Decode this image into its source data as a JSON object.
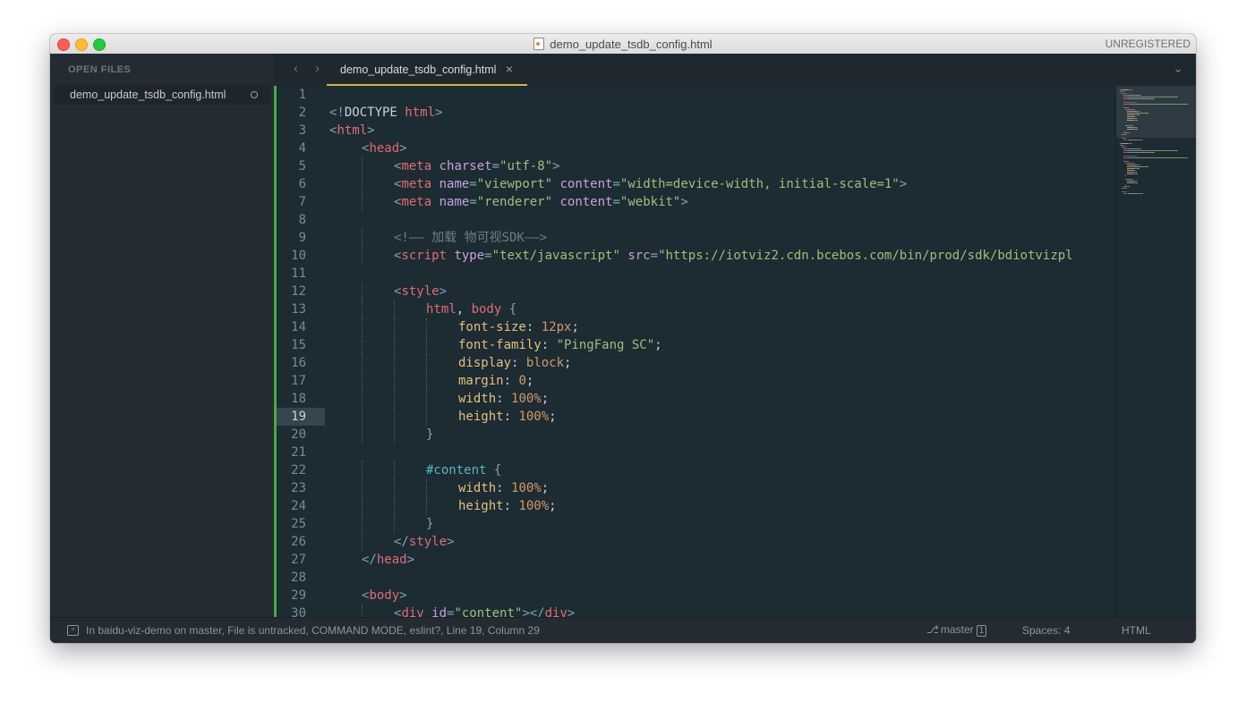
{
  "window": {
    "title": "demo_update_tsdb_config.html",
    "registration": "UNREGISTERED"
  },
  "sidebar": {
    "heading": "OPEN FILES",
    "files": [
      {
        "name": "demo_update_tsdb_config.html"
      }
    ]
  },
  "tabs": {
    "back": "‹",
    "forward": "›",
    "active": {
      "label": "demo_update_tsdb_config.html",
      "close": "×"
    },
    "menu": "⌄"
  },
  "editor": {
    "current_line": 19,
    "lines": [
      {
        "n": "1",
        "indent": 0,
        "tokens": []
      },
      {
        "n": "2",
        "indent": 0,
        "tokens": [
          [
            "punc",
            "<!"
          ],
          [
            "plain",
            "DOCTYPE "
          ],
          [
            "tag",
            "html"
          ],
          [
            "punc",
            ">"
          ]
        ]
      },
      {
        "n": "3",
        "indent": 0,
        "tokens": [
          [
            "punc",
            "<"
          ],
          [
            "tag",
            "html"
          ],
          [
            "punc",
            ">"
          ]
        ]
      },
      {
        "n": "4",
        "indent": 1,
        "tokens": [
          [
            "punc",
            "<"
          ],
          [
            "tag",
            "head"
          ],
          [
            "punc",
            ">"
          ]
        ]
      },
      {
        "n": "5",
        "indent": 2,
        "tokens": [
          [
            "punc",
            "<"
          ],
          [
            "tag",
            "meta "
          ],
          [
            "attr",
            "charset"
          ],
          [
            "punc",
            "="
          ],
          [
            "str",
            "\"utf-8\""
          ],
          [
            "punc",
            ">"
          ]
        ]
      },
      {
        "n": "6",
        "indent": 2,
        "tokens": [
          [
            "punc",
            "<"
          ],
          [
            "tag",
            "meta "
          ],
          [
            "attr",
            "name"
          ],
          [
            "punc",
            "="
          ],
          [
            "str",
            "\"viewport\" "
          ],
          [
            "attr",
            "content"
          ],
          [
            "punc",
            "="
          ],
          [
            "str",
            "\"width=device-width, initial-scale=1\""
          ],
          [
            "punc",
            ">"
          ]
        ]
      },
      {
        "n": "7",
        "indent": 2,
        "tokens": [
          [
            "punc",
            "<"
          ],
          [
            "tag",
            "meta "
          ],
          [
            "attr",
            "name"
          ],
          [
            "punc",
            "="
          ],
          [
            "str",
            "\"renderer\" "
          ],
          [
            "attr",
            "content"
          ],
          [
            "punc",
            "="
          ],
          [
            "str",
            "\"webkit\""
          ],
          [
            "punc",
            ">"
          ]
        ]
      },
      {
        "n": "8",
        "indent": 0,
        "tokens": []
      },
      {
        "n": "9",
        "indent": 2,
        "tokens": [
          [
            "comment",
            "<!—— 加载 物可视SDK——>"
          ]
        ]
      },
      {
        "n": "10",
        "indent": 2,
        "tokens": [
          [
            "punc",
            "<"
          ],
          [
            "tag",
            "script "
          ],
          [
            "attr",
            "type"
          ],
          [
            "punc",
            "="
          ],
          [
            "str",
            "\"text/javascript\" "
          ],
          [
            "attr",
            "src"
          ],
          [
            "punc",
            "="
          ],
          [
            "str",
            "\"https://iotviz2.cdn.bcebos.com/bin/prod/sdk/bdiotvizpl"
          ]
        ]
      },
      {
        "n": "11",
        "indent": 0,
        "tokens": []
      },
      {
        "n": "12",
        "indent": 2,
        "tokens": [
          [
            "punc",
            "<"
          ],
          [
            "tag",
            "style"
          ],
          [
            "punc",
            ">"
          ]
        ]
      },
      {
        "n": "13",
        "indent": 3,
        "tokens": [
          [
            "tag",
            "html"
          ],
          [
            "plain",
            ", "
          ],
          [
            "tag",
            "body "
          ],
          [
            "punc",
            "{"
          ]
        ]
      },
      {
        "n": "14",
        "indent": 4,
        "tokens": [
          [
            "prop",
            "font-size"
          ],
          [
            "plain",
            ": "
          ],
          [
            "num",
            "12px"
          ],
          [
            "plain",
            ";"
          ]
        ]
      },
      {
        "n": "15",
        "indent": 4,
        "tokens": [
          [
            "prop",
            "font-family"
          ],
          [
            "plain",
            ": "
          ],
          [
            "str",
            "\"PingFang SC\""
          ],
          [
            "plain",
            ";"
          ]
        ]
      },
      {
        "n": "16",
        "indent": 4,
        "tokens": [
          [
            "prop",
            "display"
          ],
          [
            "plain",
            ": "
          ],
          [
            "num",
            "block"
          ],
          [
            "plain",
            ";"
          ]
        ]
      },
      {
        "n": "17",
        "indent": 4,
        "tokens": [
          [
            "prop",
            "margin"
          ],
          [
            "plain",
            ": "
          ],
          [
            "num",
            "0"
          ],
          [
            "plain",
            ";"
          ]
        ]
      },
      {
        "n": "18",
        "indent": 4,
        "tokens": [
          [
            "prop",
            "width"
          ],
          [
            "plain",
            ": "
          ],
          [
            "num",
            "100%"
          ],
          [
            "plain",
            ";"
          ]
        ]
      },
      {
        "n": "19",
        "indent": 4,
        "tokens": [
          [
            "prop",
            "height"
          ],
          [
            "plain",
            ": "
          ],
          [
            "num",
            "100%"
          ],
          [
            "plain",
            ";"
          ]
        ]
      },
      {
        "n": "20",
        "indent": 3,
        "tokens": [
          [
            "punc",
            "}"
          ]
        ]
      },
      {
        "n": "21",
        "indent": 0,
        "tokens": []
      },
      {
        "n": "22",
        "indent": 3,
        "tokens": [
          [
            "sel",
            "#content "
          ],
          [
            "punc",
            "{"
          ]
        ]
      },
      {
        "n": "23",
        "indent": 4,
        "tokens": [
          [
            "prop",
            "width"
          ],
          [
            "plain",
            ": "
          ],
          [
            "num",
            "100%"
          ],
          [
            "plain",
            ";"
          ]
        ]
      },
      {
        "n": "24",
        "indent": 4,
        "tokens": [
          [
            "prop",
            "height"
          ],
          [
            "plain",
            ": "
          ],
          [
            "num",
            "100%"
          ],
          [
            "plain",
            ";"
          ]
        ]
      },
      {
        "n": "25",
        "indent": 3,
        "tokens": [
          [
            "punc",
            "}"
          ]
        ]
      },
      {
        "n": "26",
        "indent": 2,
        "tokens": [
          [
            "punc",
            "</"
          ],
          [
            "tag",
            "style"
          ],
          [
            "punc",
            ">"
          ]
        ]
      },
      {
        "n": "27",
        "indent": 1,
        "tokens": [
          [
            "punc",
            "</"
          ],
          [
            "tag",
            "head"
          ],
          [
            "punc",
            ">"
          ]
        ]
      },
      {
        "n": "28",
        "indent": 0,
        "tokens": []
      },
      {
        "n": "29",
        "indent": 1,
        "tokens": [
          [
            "punc",
            "<"
          ],
          [
            "tag",
            "body"
          ],
          [
            "punc",
            ">"
          ]
        ]
      },
      {
        "n": "30",
        "indent": 2,
        "tokens": [
          [
            "punc",
            "<"
          ],
          [
            "tag",
            "div "
          ],
          [
            "attr",
            "id"
          ],
          [
            "punc",
            "="
          ],
          [
            "str",
            "\"content\""
          ],
          [
            "punc",
            "></"
          ],
          [
            "tag",
            "div"
          ],
          [
            "punc",
            ">"
          ]
        ]
      }
    ]
  },
  "statusbar": {
    "message": "In baidu-viz-demo on master, File is untracked, COMMAND MODE, eslint?, Line 19, Column 29",
    "branch": "master",
    "branch_count": "1",
    "spaces": "Spaces: 4",
    "syntax": "HTML"
  },
  "colors": {
    "editor_bg": "#1d2b33",
    "sidebar_bg": "#252b33",
    "tab_accent": "#d6b14a",
    "modified_bar": "#43ad3e"
  }
}
